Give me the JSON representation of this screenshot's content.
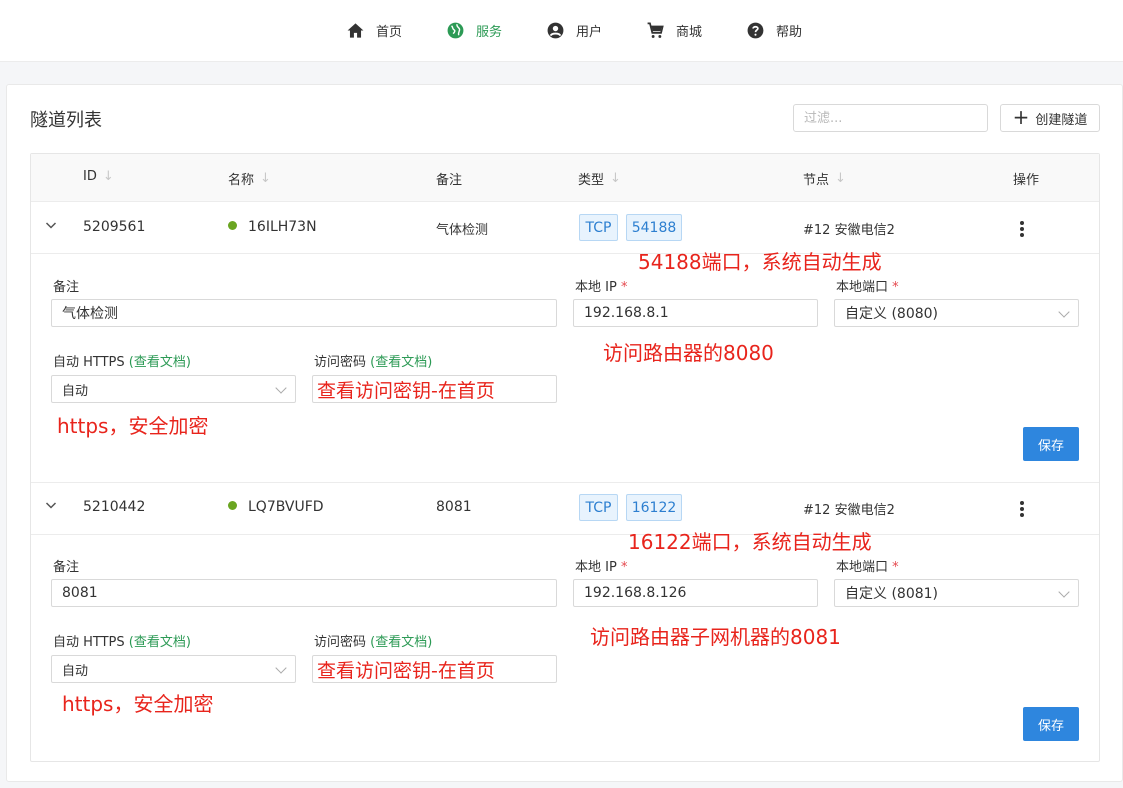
{
  "nav": {
    "items": [
      {
        "label": "首页",
        "icon": "home-icon"
      },
      {
        "label": "服务",
        "icon": "globe-icon",
        "active": true
      },
      {
        "label": "用户",
        "icon": "user-icon"
      },
      {
        "label": "商城",
        "icon": "cart-icon"
      },
      {
        "label": "帮助",
        "icon": "help-icon"
      }
    ],
    "active_color": "#2c9a55"
  },
  "page": {
    "title": "隧道列表",
    "filter_placeholder": "过滤...",
    "create_label": "创建隧道"
  },
  "table": {
    "columns": {
      "id": "ID",
      "name": "名称",
      "note": "备注",
      "type": "类型",
      "node": "节点",
      "actions": "操作"
    },
    "sort_icon": "↓",
    "rows": [
      {
        "id": "5209561",
        "name": "16ILH73N",
        "note": "气体检测",
        "protocol": "TCP",
        "port": "54188",
        "node": "#12 安徽电信2",
        "detail": {
          "note_label": "备注",
          "note_value": "气体检测",
          "local_ip_label": "本地 IP",
          "local_ip_value": "192.168.8.1",
          "local_port_label": "本地端口",
          "local_port_value": "自定义 (8080)",
          "https_label": "自动 HTTPS",
          "https_doc": "(查看文档)",
          "https_value": "自动",
          "password_label": "访问密码",
          "password_doc": "(查看文档)",
          "password_value": "查看访问密钥-在首页",
          "save_label": "保存"
        },
        "annotations": {
          "port_note": "54188端口，系统自动生成",
          "ip_note": "访问路由器的8080",
          "https_note": "https，安全加密"
        }
      },
      {
        "id": "5210442",
        "name": "LQ7BVUFD",
        "note": "8081",
        "protocol": "TCP",
        "port": "16122",
        "node": "#12 安徽电信2",
        "detail": {
          "note_label": "备注",
          "note_value": "8081",
          "local_ip_label": "本地 IP",
          "local_ip_value": "192.168.8.126",
          "local_port_label": "本地端口",
          "local_port_value": "自定义 (8081)",
          "https_label": "自动 HTTPS",
          "https_doc": "(查看文档)",
          "https_value": "自动",
          "password_label": "访问密码",
          "password_doc": "(查看文档)",
          "password_value": "查看访问密钥-在首页",
          "save_label": "保存"
        },
        "annotations": {
          "port_note": "16122端口，系统自动生成",
          "ip_note": "访问路由器子网机器的8081",
          "https_note": "https，安全加密"
        }
      }
    ]
  },
  "colors": {
    "status_online": "#6aa521",
    "tag_text": "#2d7fd0",
    "primary": "#2e86de",
    "annotation": "#e8241c",
    "required": "#e5484d"
  }
}
